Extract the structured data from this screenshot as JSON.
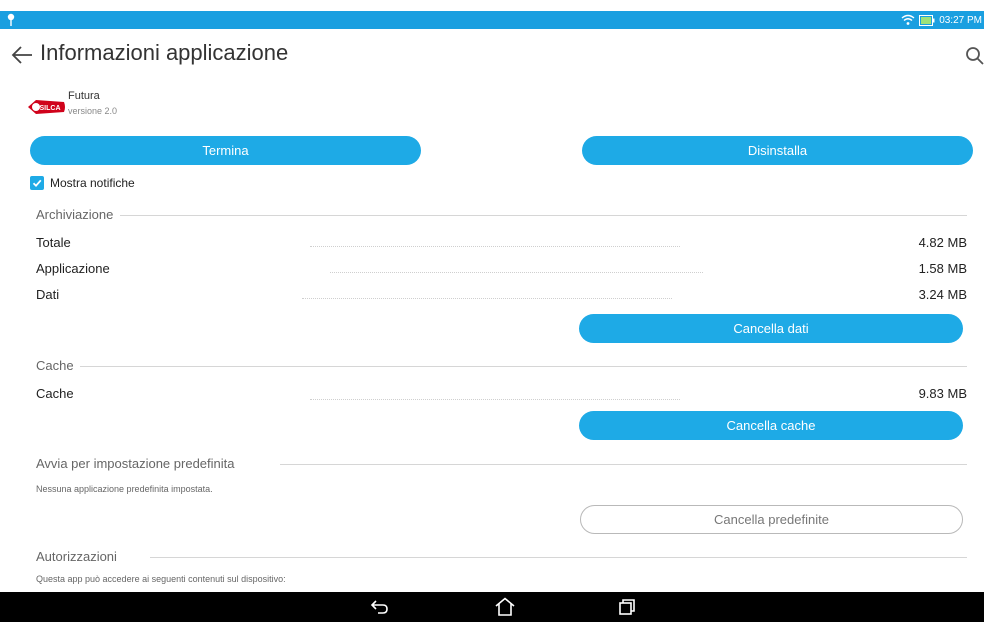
{
  "status": {
    "time": "03:27 PM",
    "colors": {
      "bar": "#1a9fe0"
    }
  },
  "header": {
    "title": "Informazioni applicazione"
  },
  "app": {
    "name": "Futura",
    "version": "versione 2.0",
    "logo_text": "SILCA"
  },
  "actions": {
    "stop_label": "Termina",
    "uninstall_label": "Disinstalla"
  },
  "notifications": {
    "label": "Mostra notifiche",
    "checked": true
  },
  "storage": {
    "title": "Archiviazione",
    "rows": [
      {
        "label": "Totale",
        "value": "4.82 MB"
      },
      {
        "label": "Applicazione",
        "value": "1.58 MB"
      },
      {
        "label": "Dati",
        "value": "3.24 MB"
      }
    ],
    "clear_label": "Cancella dati"
  },
  "cache": {
    "title": "Cache",
    "row": {
      "label": "Cache",
      "value": "9.83 MB"
    },
    "clear_label": "Cancella cache"
  },
  "defaults": {
    "title": "Avvia per impostazione predefinita",
    "description": "Nessuna applicazione predefinita impostata.",
    "clear_label": "Cancella predefinite"
  },
  "permissions": {
    "title": "Autorizzazioni",
    "description": "Questa app può accedere ai seguenti contenuti sul dispositivo:"
  },
  "colors": {
    "accent": "#1eaae6",
    "nav_bar": "#000000"
  },
  "icons": [
    "location-pin-icon",
    "wifi-icon",
    "battery-icon",
    "back-arrow-icon",
    "search-icon",
    "check-icon",
    "nav-back-icon",
    "nav-home-icon",
    "nav-recents-icon"
  ]
}
